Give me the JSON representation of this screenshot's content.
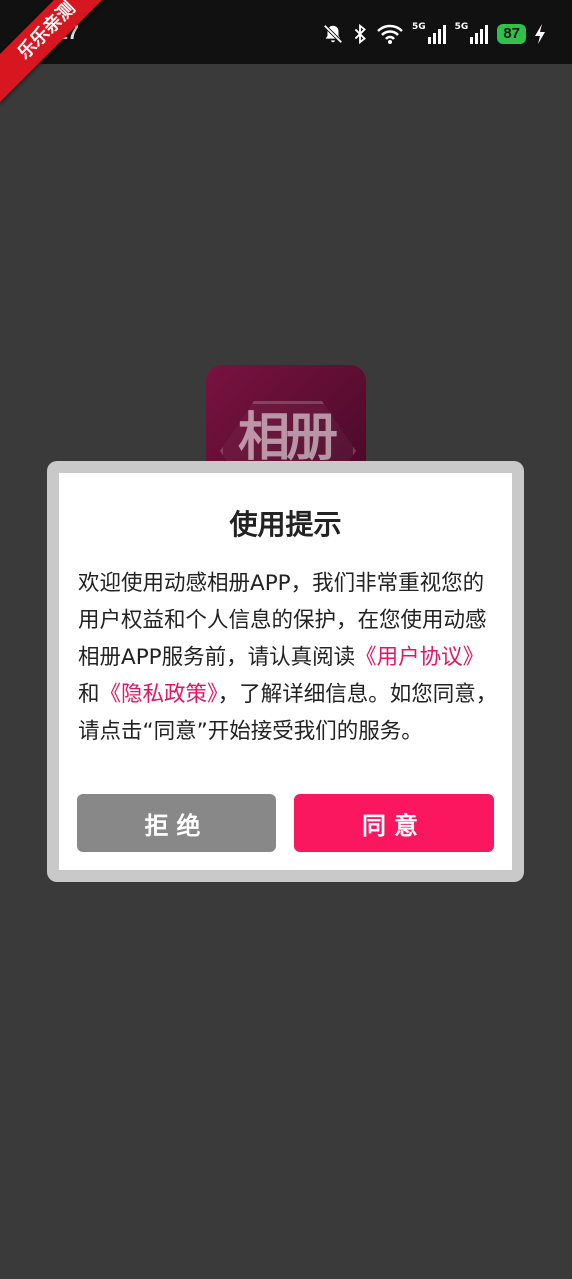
{
  "status_bar": {
    "time": ":17",
    "network_label_1": "5G",
    "network_label_2": "5G",
    "battery": "87",
    "icons": [
      "mute-bell-icon",
      "bluetooth-icon",
      "wifi-icon",
      "signal-icon",
      "signal-icon",
      "battery-icon",
      "charging-icon"
    ]
  },
  "watermark": {
    "text": "乐乐亲测"
  },
  "app_logo": {
    "text": "相册"
  },
  "dialog": {
    "title": "使用提示",
    "body_part1": "欢迎使用动感相册APP，我们非常重视您的用户权益和个人信息的保护，在您使用动感相册APP服务前，请认真阅读",
    "link_user_agreement": "《用户协议》",
    "body_and": "和",
    "link_privacy_policy": "《隐私政策》",
    "body_part2": "，了解详细信息。如您同意，请点击“同意”开始接受我们的服务。",
    "refuse_label": "拒绝",
    "agree_label": "同意"
  },
  "colors": {
    "accent": "#fb1660",
    "link": "#e5155f",
    "refuse_button": "#888888",
    "overlay": "#3a3a3a",
    "battery": "#2fc24a"
  }
}
